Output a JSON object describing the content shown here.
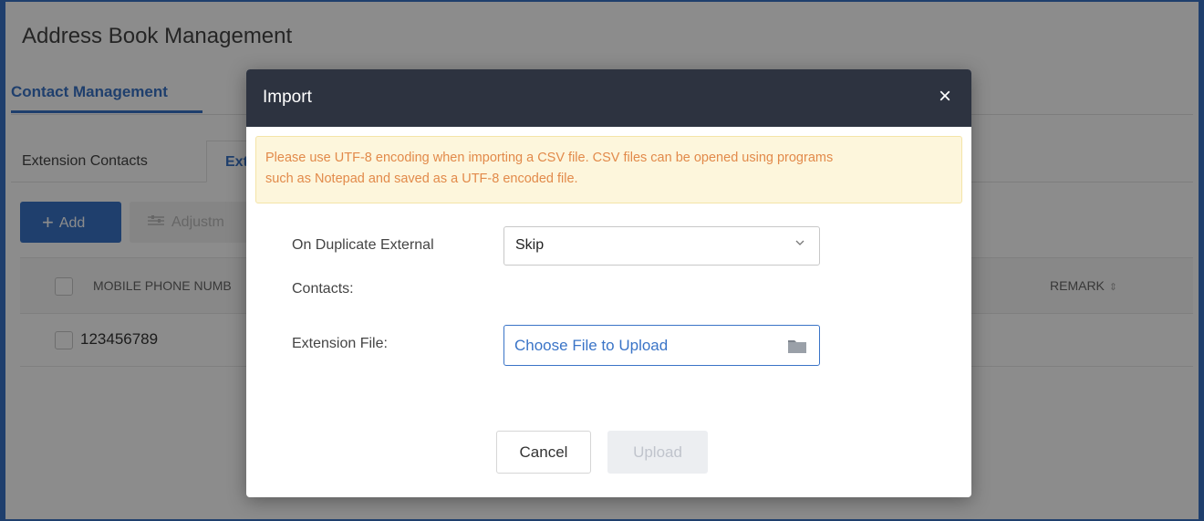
{
  "page": {
    "title": "Address Book Management",
    "top_tab_active": "Contact Management",
    "sub_tabs": [
      "Extension Contacts",
      "Ext"
    ],
    "toolbar": {
      "add_label": "Add",
      "adjust_label": "Adjustm"
    },
    "table": {
      "headers": {
        "mobile": "MOBILE PHONE NUMB",
        "remark": "REMARK"
      },
      "rows": [
        {
          "mobile": "123456789"
        }
      ]
    }
  },
  "modal": {
    "title": "Import",
    "close_glyph": "×",
    "warning_line1": "Please use UTF-8 encoding when importing a CSV file. CSV files can be opened using programs",
    "warning_line2": "such as Notepad and saved as a UTF-8 encoded file.",
    "duplicate_label_line1": "On Duplicate External",
    "duplicate_label_line2": "Contacts:",
    "duplicate_value": "Skip",
    "file_label": "Extension File:",
    "file_placeholder": "Choose File to Upload",
    "cancel_label": "Cancel",
    "upload_label": "Upload"
  },
  "colors": {
    "accent": "#3a74c7",
    "modal_header": "#2d3340",
    "warning_text": "#e28a4a",
    "warning_bg": "#fdf6dc"
  },
  "icons": [
    "plus-icon",
    "adjust-icon",
    "sort-icon",
    "close-icon",
    "chevron-down-icon",
    "folder-icon"
  ]
}
